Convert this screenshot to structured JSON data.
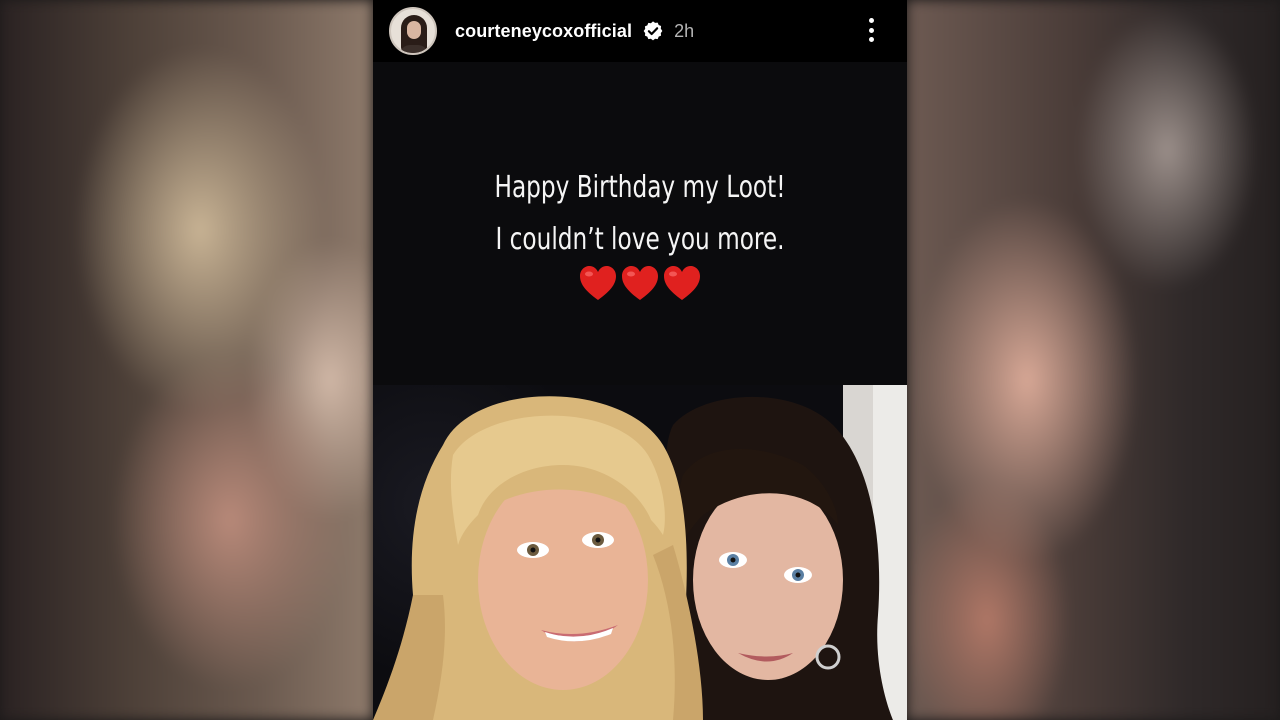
{
  "story": {
    "username": "courteneycoxofficial",
    "timestamp": "2h",
    "message_lines": [
      "Happy Birthday my Loot!",
      "I couldn’t love you more."
    ],
    "hearts": "❤️❤️❤️",
    "icons": {
      "avatar": "profile-avatar",
      "verified": "verified-badge-icon",
      "more": "more-options-icon"
    },
    "colors": {
      "heart": "#e0211f",
      "verified": "#ffffff",
      "background": "#000000"
    }
  }
}
